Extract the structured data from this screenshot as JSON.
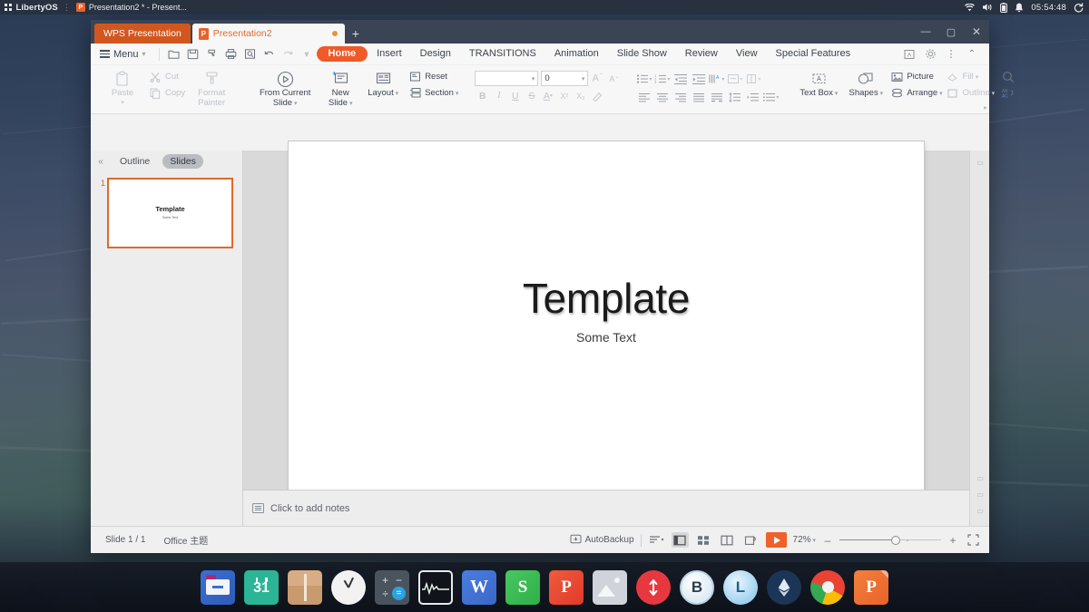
{
  "system_bar": {
    "os_name": "LibertyOS",
    "window_title": "Presentation2 * - Present...",
    "clock": "05:54:48",
    "icons": [
      "apps-grid-icon",
      "wps-presentation-icon",
      "wifi-icon",
      "volume-icon",
      "battery-icon",
      "bell-icon",
      "power-icon"
    ]
  },
  "window": {
    "app_tab": "WPS Presentation",
    "doc_tab": "Presentation2",
    "new_tab_label": "+",
    "controls": {
      "minimize": "—",
      "maximize": "▢",
      "close": "✕"
    }
  },
  "menubar": {
    "menu_label": "Menu",
    "quick_access": [
      "open-icon",
      "save-icon",
      "save-as-icon",
      "print-icon",
      "print-preview-icon",
      "undo-icon",
      "redo-icon",
      "customize-toolbar-icon"
    ],
    "tabs": [
      {
        "label": "Home",
        "active": true
      },
      {
        "label": "Insert",
        "active": false
      },
      {
        "label": "Design",
        "active": false
      },
      {
        "label": "TRANSITIONS",
        "active": false
      },
      {
        "label": "Animation",
        "active": false
      },
      {
        "label": "Slide Show",
        "active": false
      },
      {
        "label": "Review",
        "active": false
      },
      {
        "label": "View",
        "active": false
      },
      {
        "label": "Special Features",
        "active": false
      }
    ],
    "right_icons": [
      "text-tools-icon",
      "settings-gear-icon",
      "more-options-icon",
      "collapse-ribbon-icon"
    ]
  },
  "ribbon": {
    "paste": "Paste",
    "cut": "Cut",
    "copy": "Copy",
    "format_painter_line1": "Format",
    "format_painter_line2": "Painter",
    "from_current_line1": "From Current",
    "from_current_line2": "Slide",
    "new_slide_line1": "New",
    "new_slide_line2": "Slide",
    "layout": "Layout",
    "reset": "Reset",
    "section": "Section",
    "font_name": "",
    "font_size": "0",
    "grow_font": "A",
    "shrink_font": "A",
    "bold": "B",
    "italic": "I",
    "underline": "U",
    "strikethrough": "S",
    "font_color": "A",
    "superscript": "X²",
    "subscript": "X₂",
    "clear_format": "clear-formatting-icon",
    "text_box": "Text Box",
    "shapes": "Shapes",
    "picture": "Picture",
    "arrange": "Arrange",
    "fill": "Fill",
    "outline": "Outline",
    "find_icon": "search-icon",
    "replace_icon": "replace-icon"
  },
  "slide_panel": {
    "collapse": "«",
    "tab_outline": "Outline",
    "tab_slides": "Slides",
    "thumbnails": [
      {
        "number": "1",
        "title": "Template",
        "subtitle": "Some Text"
      }
    ]
  },
  "slide": {
    "title": "Template",
    "subtitle": "Some Text"
  },
  "notes": {
    "placeholder": "Click to add notes"
  },
  "status_bar": {
    "slide_count": "Slide 1 / 1",
    "theme": "Office 主题",
    "autobackup": "AutoBackup",
    "zoom": "72%",
    "minus": "–",
    "plus": "+",
    "views": [
      "view-options-icon",
      "normal-view-icon",
      "slide-sorter-icon",
      "reading-view-icon",
      "notes-view-icon"
    ],
    "play": "play-slideshow-icon",
    "fit": "fit-to-window-icon"
  },
  "dock": {
    "items": [
      {
        "name": "files",
        "label": "Files"
      },
      {
        "name": "calendar",
        "label": "31"
      },
      {
        "name": "archive",
        "label": "Archive Manager"
      },
      {
        "name": "clock",
        "label": "Clock"
      },
      {
        "name": "calculator",
        "label": "Calculator"
      },
      {
        "name": "system-monitor",
        "label": "System Monitor"
      },
      {
        "name": "wps-writer",
        "label": "W"
      },
      {
        "name": "wps-spreadsheet",
        "label": "S"
      },
      {
        "name": "wps-pdf",
        "label": "P"
      },
      {
        "name": "image-viewer",
        "label": "Image Viewer"
      },
      {
        "name": "transfer",
        "label": "Transfer"
      },
      {
        "name": "bitcoin",
        "label": "B"
      },
      {
        "name": "litecoin",
        "label": "L"
      },
      {
        "name": "ethereum",
        "label": "Ethereum"
      },
      {
        "name": "chromium",
        "label": "Chromium"
      },
      {
        "name": "wps-presentation",
        "label": "P"
      }
    ]
  },
  "colors": {
    "accent": "#f05a28",
    "tab_orange": "#d2571f",
    "topbar": "#27313f",
    "ribbon_bg": "#f7f7f7",
    "canvas_bg": "#d9d9d9"
  }
}
